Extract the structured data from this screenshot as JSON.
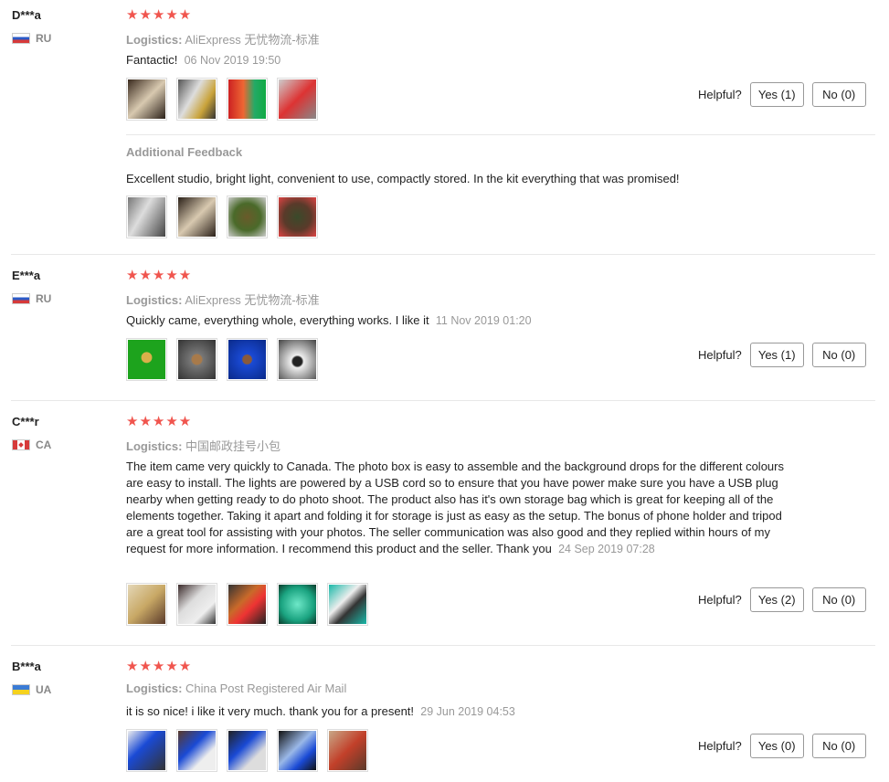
{
  "helpful_label": "Helpful?",
  "logistics_label": "Logistics:",
  "reviews": [
    {
      "user": "D***a",
      "country": "RU",
      "stars": "★★★★★",
      "logistics": "AliExpress 无忧物流-标准",
      "text": "Fantactic!",
      "date": "06 Nov 2019 19:50",
      "yes": "Yes (1)",
      "no": "No (0)",
      "additional_title": "Additional Feedback",
      "additional_text": "Excellent studio, bright light, convenient to use, compactly stored. In the kit everything that was promised!"
    },
    {
      "user": "E***a",
      "country": "RU",
      "stars": "★★★★★",
      "logistics": "AliExpress 无忧物流-标准",
      "text": "Quickly came, everything whole, everything works. I like it",
      "date": "11 Nov 2019 01:20",
      "yes": "Yes (1)",
      "no": "No (0)"
    },
    {
      "user": "C***r",
      "country": "CA",
      "stars": "★★★★★",
      "logistics": "中国邮政挂号小包",
      "text": "The item came very quickly to Canada. The photo box is easy to assemble and the background drops for the different colours are easy to install. The lights are powered by a USB cord so to ensure that you have power make sure you have a USB plug nearby when getting ready to do photo shoot. The product also has it's own storage bag which is great for keeping all of the elements together. Taking it apart and folding it for storage is just as easy as the setup. The bonus of phone holder and tripod are a great tool for assisting with your photos. The seller communication was also good and they replied within hours of my request for more information. I recommend this product and the seller. Thank you",
      "date": "24 Sep 2019 07:28",
      "yes": "Yes (2)",
      "no": "No (0)"
    },
    {
      "user": "B***a",
      "country": "UA",
      "stars": "★★★★★",
      "logistics": "China Post Registered Air Mail",
      "text": "it is so nice! i like it very much. thank you for a present!",
      "date": "29 Jun 2019 04:53",
      "yes": "Yes (0)",
      "no": "No (0)"
    }
  ]
}
